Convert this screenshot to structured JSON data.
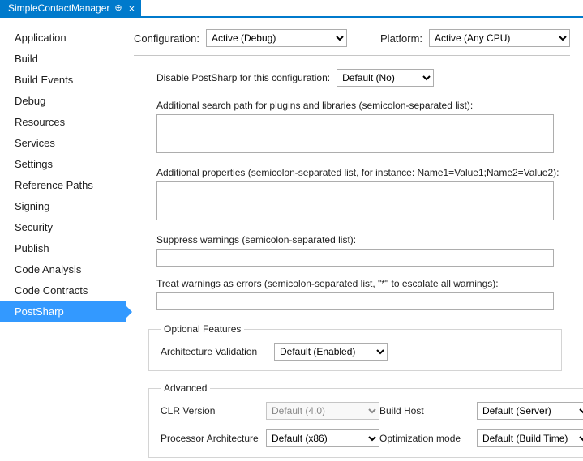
{
  "tab": {
    "title": "SimpleContactManager"
  },
  "topbar": {
    "configuration_label": "Configuration:",
    "configuration_value": "Active (Debug)",
    "platform_label": "Platform:",
    "platform_value": "Active (Any CPU)"
  },
  "sidebar": {
    "items": [
      {
        "label": "Application"
      },
      {
        "label": "Build"
      },
      {
        "label": "Build Events"
      },
      {
        "label": "Debug"
      },
      {
        "label": "Resources"
      },
      {
        "label": "Services"
      },
      {
        "label": "Settings"
      },
      {
        "label": "Reference Paths"
      },
      {
        "label": "Signing"
      },
      {
        "label": "Security"
      },
      {
        "label": "Publish"
      },
      {
        "label": "Code Analysis"
      },
      {
        "label": "Code Contracts"
      },
      {
        "label": "PostSharp"
      }
    ],
    "selected_index": 13
  },
  "form": {
    "disable_label": "Disable PostSharp for this configuration:",
    "disable_value": "Default (No)",
    "search_path_label": "Additional search path for plugins and libraries (semicolon-separated list):",
    "search_path_value": "",
    "props_label": "Additional properties (semicolon-separated list, for instance: Name1=Value1;Name2=Value2):",
    "props_value": "",
    "suppress_label": "Suppress warnings (semicolon-separated list):",
    "suppress_value": "",
    "errors_label": "Treat warnings as errors (semicolon-separated list, \"*\" to escalate all warnings):",
    "errors_value": ""
  },
  "optional": {
    "legend": "Optional Features",
    "arch_validation_label": "Architecture Validation",
    "arch_validation_value": "Default (Enabled)"
  },
  "advanced": {
    "legend": "Advanced",
    "clr_label": "CLR Version",
    "clr_value": "Default (4.0)",
    "host_label": "Build Host",
    "host_value": "Default (Server)",
    "proc_label": "Processor Architecture",
    "proc_value": "Default (x86)",
    "opt_label": "Optimization mode",
    "opt_value": "Default (Build Time)"
  }
}
